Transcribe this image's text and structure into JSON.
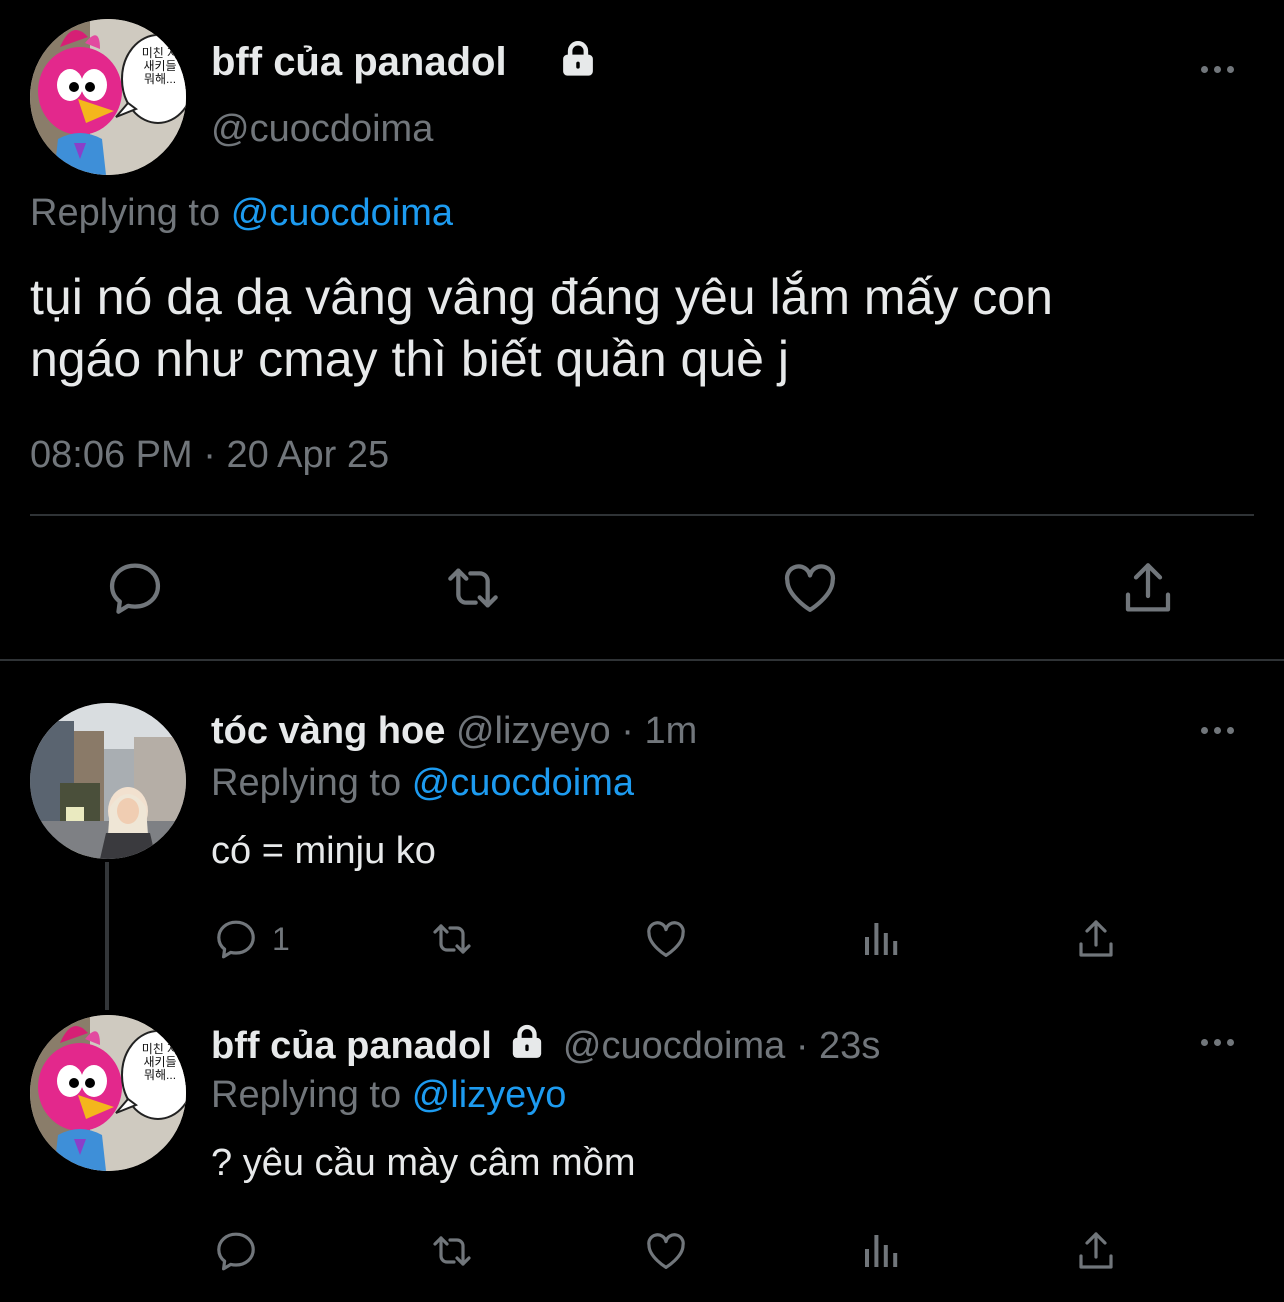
{
  "main_tweet": {
    "display_name": "bff của panadol",
    "handle": "@cuocdoima",
    "replying_prefix": "Replying to",
    "replying_to": "@cuocdoima",
    "text_line1": "tụi nó dạ dạ vâng vâng đáng yêu lắm mấy con",
    "text_line2": "ngáo như cmay thì biết quần què j",
    "time": "08:06 PM",
    "separator": "·",
    "date": "20 Apr 25",
    "avatar_speech": "미친 자\n새키들\n뭐해..."
  },
  "replies": [
    {
      "display_name": "tóc vàng hoe",
      "handle": "@lizyeyo",
      "separator": "·",
      "age": "1m",
      "replying_prefix": "Replying to",
      "replying_to": "@cuocdoima",
      "text": "có = minju ko",
      "reply_count": "1"
    },
    {
      "display_name": "bff của panadol",
      "handle": "@cuocdoima",
      "separator": "·",
      "age": "23s",
      "replying_prefix": "Replying to",
      "replying_to": "@lizyeyo",
      "text": "? yêu cầu mày câm mồm",
      "avatar_speech": "미친 자\n새키들\n뭐해..."
    }
  ],
  "colors": {
    "background": "#000000",
    "text": "#e7e9ea",
    "muted": "#71767b",
    "link": "#1d9bf0",
    "divider": "#2f3336"
  },
  "icons": [
    "lock-icon",
    "more-icon",
    "reply-icon",
    "retweet-icon",
    "like-icon",
    "share-icon",
    "views-icon"
  ]
}
